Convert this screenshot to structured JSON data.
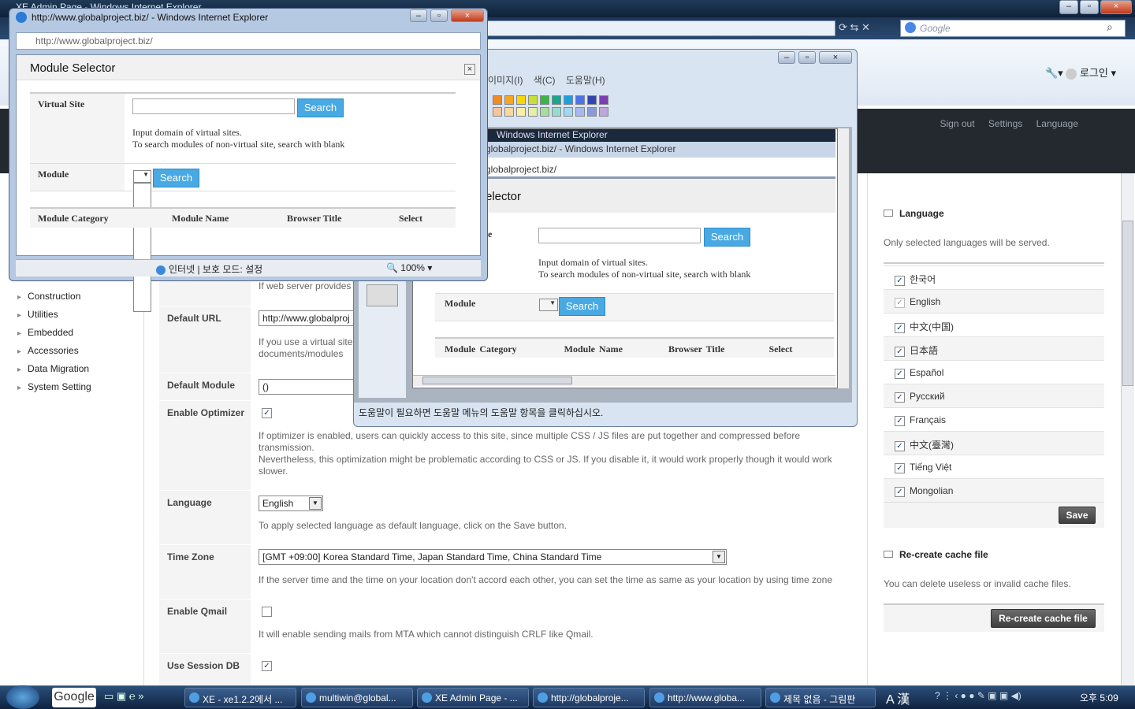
{
  "main_window": {
    "title": "XE Admin Page - Windows Internet Explorer",
    "search_placeholder": "Google",
    "login_label": "로그인"
  },
  "admin_header": {
    "links": [
      "Sign out",
      "Settings",
      "Language"
    ]
  },
  "left_nav": {
    "items": [
      "Construction",
      "Utilities",
      "Embedded",
      "Accessories",
      "Data Migration",
      "System Setting"
    ]
  },
  "settings": {
    "top_help": "If web server provides",
    "default_url": {
      "label": "Default URL",
      "value": "http://www.globalproj",
      "help": "If you use a virtual site\ndocuments/modules"
    },
    "default_module": {
      "label": "Default Module",
      "value": "()"
    },
    "enable_optimizer": {
      "label": "Enable Optimizer",
      "checked": true,
      "help": "If optimizer is enabled, users can quickly access to this site, since multiple CSS / JS files are put together and compressed before transmission.\nNevertheless, this optimization might be problematic according to CSS or JS. If you disable it, it would work properly though it would work slower."
    },
    "language": {
      "label": "Language",
      "value": "English",
      "help": "To apply selected language as default language, click on the Save button."
    },
    "time_zone": {
      "label": "Time Zone",
      "value": "[GMT +09:00] Korea Standard Time, Japan Standard Time, China Standard Time",
      "help": "If the server time and the time on your location don't accord each other, you can set the time as same as your location by using time zone"
    },
    "enable_qmail": {
      "label": "Enable Qmail",
      "checked": false,
      "help": "It will enable sending mails from MTA which cannot distinguish CRLF like Qmail."
    },
    "use_session_db": {
      "label": "Use Session DB",
      "checked": true
    }
  },
  "right_panel": {
    "language_title": "Language",
    "language_desc": "Only selected languages will be served.",
    "languages": [
      "한국어",
      "English",
      "中文(中国)",
      "日本語",
      "Español",
      "Русский",
      "Français",
      "中文(臺灣)",
      "Tiếng Việt",
      "Mongolian"
    ],
    "save_label": "Save",
    "cache_title": "Re-create cache file",
    "cache_desc": "You can delete useless or invalid cache files.",
    "cache_button": "Re-create cache file"
  },
  "paint_window": {
    "menu_items": [
      "이미지(I)",
      "색(C)",
      "도움말(H)"
    ],
    "inner_title": "Windows Internet Explorer",
    "inner_title2": "globalproject.biz/ - Windows Internet Explorer",
    "inner_address": "globalproject.biz/",
    "inner_heading": "elector",
    "inner_site_label_tail": "e",
    "status_text": "도움말이 필요하면 도움말 메뉴의 도움말 항목을 클릭하십시오.",
    "palette": [
      "#f08a24",
      "#f5a623",
      "#f7d708",
      "#c6e038",
      "#3bb54a",
      "#1aa58f",
      "#1ba0e2",
      "#4b72e8",
      "#3346b0",
      "#7a3fb0",
      "#f7c39a",
      "#f9d89a",
      "#fbeea0",
      "#e3f0a8",
      "#a8dca0",
      "#98dccf",
      "#a0d7f2",
      "#a8b8f0",
      "#8a9ad8",
      "#bea6d8"
    ]
  },
  "popup": {
    "title": "http://www.globalproject.biz/ - Windows Internet Explorer",
    "address": "http://www.globalproject.biz/",
    "heading": "Module Selector",
    "close_glyph": "×",
    "virtual_site_label": "Virtual Site",
    "module_label": "Module",
    "search_label": "Search",
    "help_line1": "Input domain of virtual sites.",
    "help_line2": "To search modules of non-virtual site, search with blank",
    "columns": [
      "Module Category",
      "Module Name",
      "Browser Title",
      "Select"
    ],
    "status_zone": "인터넷 | 보호 모드: 설정",
    "zoom": "100%"
  },
  "taskbar": {
    "search_label": "Google",
    "tasks": [
      "XE - xe1.2.2에서 ...",
      "multiwin@global...",
      "XE Admin Page - ...",
      "http://globalproje...",
      "http://www.globa...",
      "제목 없음 - 그림판"
    ],
    "ime": "A 漢",
    "clock": "오후 5:09"
  },
  "colors": {
    "accent_blue": "#48a9e3",
    "header_dark": "#23292f"
  }
}
